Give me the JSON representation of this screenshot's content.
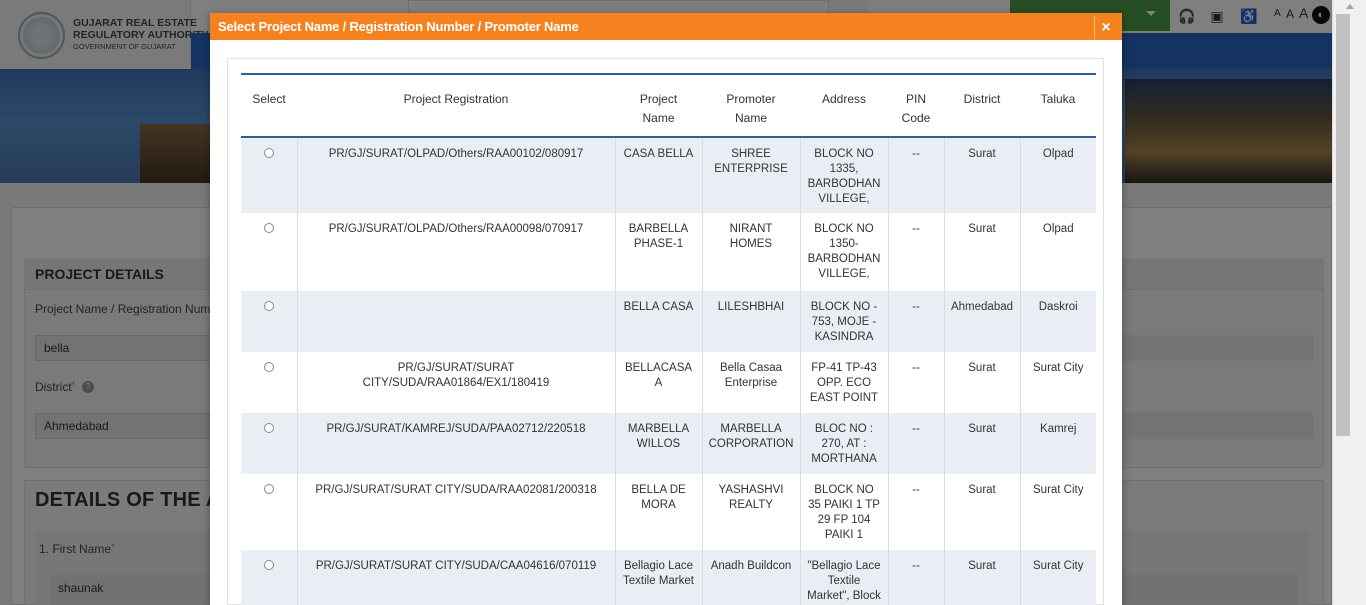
{
  "header": {
    "logo_line1": "GUJARAT REAL ESTATE",
    "logo_line2": "REGULATORY AUTHORITY",
    "logo_line3": "GOVERNMENT OF GUJARAT",
    "text_size_small": "A",
    "text_size_medium": "A",
    "text_size_large": "A",
    "contrast_label": "◐"
  },
  "form": {
    "section_title": "PROJECT DETAILS",
    "project_label": "Project Name / Registration Numbe",
    "project_value": "bella",
    "district_label": "District",
    "district_required": "*",
    "district_value": "Ahmedabad",
    "details_title": "DETAILS OF THE AP",
    "first_name_label": "1. First Name",
    "first_name_required": "*",
    "first_name_value": "shaunak"
  },
  "modal": {
    "title": "Select Project Name / Registration Number / Promoter Name",
    "close_label": "×",
    "columns": {
      "select": "Select",
      "registration": "Project Registration",
      "project_name": "Project Name",
      "promoter_name": "Promoter Name",
      "address": "Address",
      "pin": "PIN Code",
      "district": "District",
      "taluka": "Taluka"
    },
    "rows": [
      {
        "registration": "PR/GJ/SURAT/OLPAD/Others/RAA00102/080917",
        "project_name": "CASA BELLA",
        "promoter_name": "SHREE ENTERPRISE",
        "address": "BLOCK NO 1335, BARBODHAN VILLEGE,",
        "pin": "--",
        "district": "Surat",
        "taluka": "Olpad"
      },
      {
        "registration": "PR/GJ/SURAT/OLPAD/Others/RAA00098/070917",
        "project_name": "BARBELLA PHASE-1",
        "promoter_name": "NIRANT HOMES",
        "address": "BLOCK NO 1350- BARBODHAN VILLEGE,",
        "pin": "--",
        "district": "Surat",
        "taluka": "Olpad"
      },
      {
        "registration": "",
        "project_name": "BELLA CASA",
        "promoter_name": "LILESHBHAI",
        "address": "BLOCK NO - 753, MOJE - KASINDRA",
        "pin": "--",
        "district": "Ahmedabad",
        "taluka": "Daskroi"
      },
      {
        "registration": "PR/GJ/SURAT/SURAT CITY/SUDA/RAA01864/EX1/180419",
        "project_name": "BELLACASAA",
        "promoter_name": "Bella Casaa Enterprise",
        "address": "FP-41 TP-43 OPP. ECO EAST POINT",
        "pin": "--",
        "district": "Surat",
        "taluka": "Surat City"
      },
      {
        "registration": "PR/GJ/SURAT/KAMREJ/SUDA/PAA02712/220518",
        "project_name": "MARBELLA WILLOS",
        "promoter_name": "MARBELLA CORPORATION",
        "address": "BLOC NO : 270, AT : MORTHANA",
        "pin": "--",
        "district": "Surat",
        "taluka": "Kamrej"
      },
      {
        "registration": "PR/GJ/SURAT/SURAT CITY/SUDA/RAA02081/200318",
        "project_name": "BELLA DE MORA",
        "promoter_name": "YASHASHVI REALTY",
        "address": "BLOCK NO 35 PAIKI 1 TP 29 FP 104 PAIKI 1",
        "pin": "--",
        "district": "Surat",
        "taluka": "Surat City"
      },
      {
        "registration": "PR/GJ/SURAT/SURAT CITY/SUDA/CAA04616/070119",
        "project_name": "Bellagio Lace Textile Market",
        "promoter_name": "Anadh Buildcon",
        "address": "\"Bellagio Lace Textile Market\", Block",
        "pin": "--",
        "district": "Surat",
        "taluka": "Surat City"
      }
    ]
  }
}
